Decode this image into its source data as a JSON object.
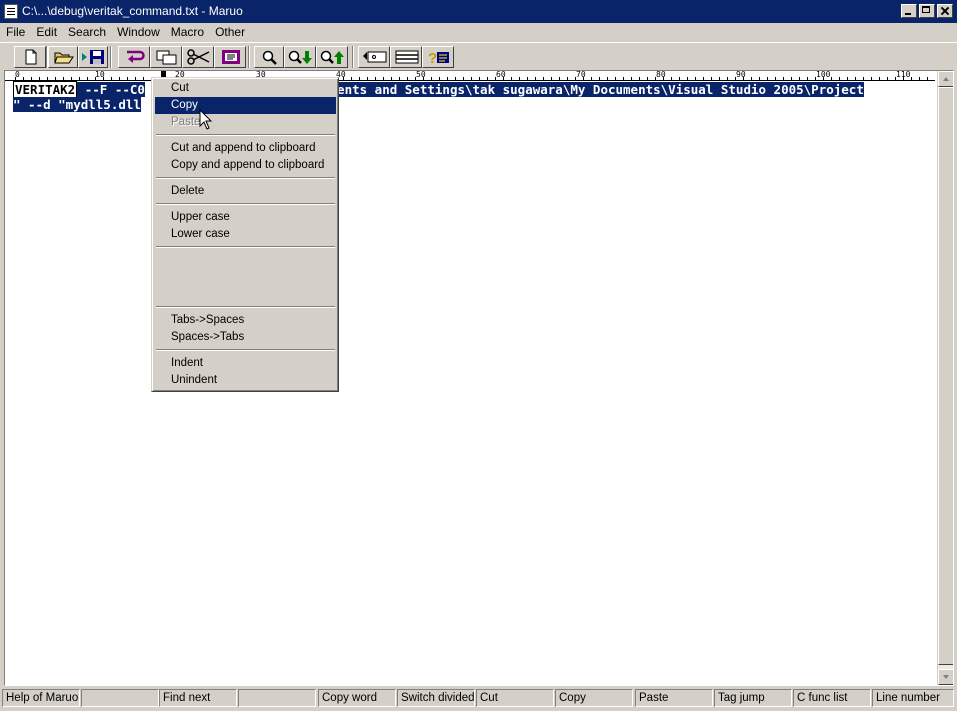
{
  "window": {
    "title": "C:\\...\\debug\\veritak_command.txt  - Maruo"
  },
  "menubar": {
    "items": [
      "File",
      "Edit",
      "Search",
      "Window",
      "Macro",
      "Other"
    ]
  },
  "toolbar": {
    "buttons": [
      "new-file",
      "open-folder",
      "save",
      "word-wrap",
      "copy-window",
      "cut",
      "paste",
      "find",
      "find-next",
      "find-previous",
      "tag-jump",
      "split-window",
      "help"
    ]
  },
  "ruler": {
    "labels": [
      "0",
      "10",
      "20",
      "30",
      "40",
      "50",
      "60",
      "70",
      "80",
      "90",
      "100",
      "110"
    ]
  },
  "editor": {
    "line1_word": "VERITAK2",
    "line1_a": " --F --C0",
    "line1_b": "ocuments and Settings\\tak sugawara\\My Documents\\Visual Studio 2005\\Project",
    "line2": "\" --d \"mydll5.dll"
  },
  "context_menu": {
    "cut": "Cut",
    "copy": "Copy",
    "paste": "Paste",
    "cut_append": "Cut and append to clipboard",
    "copy_append": "Copy and append to clipboard",
    "delete": "Delete",
    "upper": "Upper case",
    "lower": "Lower case",
    "tabs_spaces": "Tabs->Spaces",
    "spaces_tabs": "Spaces->Tabs",
    "indent": "Indent",
    "unindent": "Unindent"
  },
  "statusbar": {
    "cells": [
      "Help of Maruo",
      "",
      "Find next",
      "",
      "Copy word",
      "Switch divided window",
      "Cut",
      "Copy",
      "Paste",
      "Tag jump",
      "C func list",
      "Line number"
    ]
  },
  "colors": {
    "selection": "#0a246a",
    "chrome": "#d4d0c8"
  }
}
